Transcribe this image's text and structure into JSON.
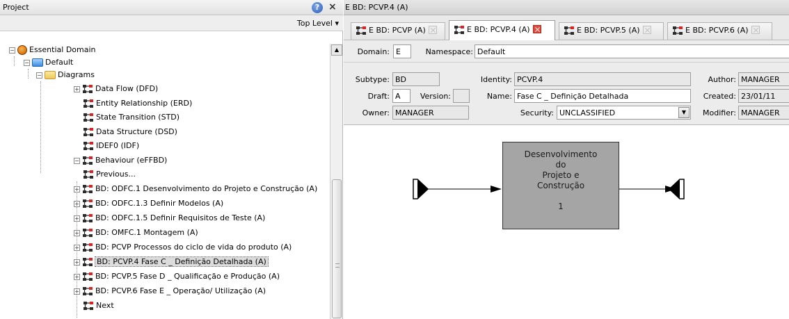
{
  "left_panel": {
    "title": "Project",
    "help_icon": "?",
    "close_icon": "×",
    "top_level_label": "Top Level",
    "tree": [
      {
        "label": "Essential Domain"
      },
      {
        "label": "Default"
      },
      {
        "label": "Diagrams"
      },
      {
        "label": "Data Flow (DFD)"
      },
      {
        "label": "Entity Relationship (ERD)"
      },
      {
        "label": "State Transition (STD)"
      },
      {
        "label": "Data Structure (DSD)"
      },
      {
        "label": "IDEF0 (IDF)"
      },
      {
        "label": "Behaviour (eFFBD)"
      },
      {
        "label": "Previous..."
      },
      {
        "label": "BD: ODFC.1 Desenvolvimento do Projeto e Construção (A)"
      },
      {
        "label": "BD: ODFC.1.3 Definir Modelos (A)"
      },
      {
        "label": "BD: ODFC.1.5 Definir Requisitos de Teste (A)"
      },
      {
        "label": "BD: OMFC.1 Montagem (A)"
      },
      {
        "label": "BD: PCVP Processos do ciclo de vida do produto (A)"
      },
      {
        "label": "BD: PCVP.4 Fase C _ Definição Detalhada (A)",
        "selected": true
      },
      {
        "label": "BD: PCVP.5 Fase D _ Qualificação e Produção (A)"
      },
      {
        "label": "BD: PCVP.6 Fase E _ Operação/ Utilização (A)"
      },
      {
        "label": "Next"
      }
    ]
  },
  "editor": {
    "title": "E BD: PCVP.4 (A)",
    "tabs": [
      {
        "label": "E BD: PCVP (A)",
        "active": false
      },
      {
        "label": "E BD: PCVP.4 (A)",
        "active": true
      },
      {
        "label": "E BD: PCVP.5 (A)",
        "active": false
      },
      {
        "label": "E BD: PCVP.6 (A)",
        "active": false
      }
    ],
    "properties": {
      "domain_label": "Domain:",
      "domain_value": "E",
      "namespace_label": "Namespace:",
      "namespace_value": "Default",
      "subtype_label": "Subtype:",
      "subtype_value": "BD",
      "identity_label": "Identity:",
      "identity_value": "PCVP.4",
      "author_label": "Author:",
      "author_value": "MANAGER",
      "draft_label": "Draft:",
      "draft_value": "A",
      "version_label": "Version:",
      "version_value": "",
      "name_label": "Name:",
      "name_value": "Fase C _ Definição Detalhada",
      "created_label": "Created:",
      "created_value": "23/01/11",
      "owner_label": "Owner:",
      "owner_value": "MANAGER",
      "security_label": "Security:",
      "security_value": "UNCLASSIFIED",
      "modifier_label": "Modifier:",
      "modifier_value": "MANAGER"
    },
    "diagram": {
      "function_lines": [
        "Desenvolvimento",
        "do",
        "Projeto e",
        "Construção"
      ],
      "function_number": "1",
      "box_fill": "#a5a5a5"
    }
  },
  "colors": {
    "selection": "#dcdcdc",
    "active_tab_close": "#e04a3c"
  }
}
